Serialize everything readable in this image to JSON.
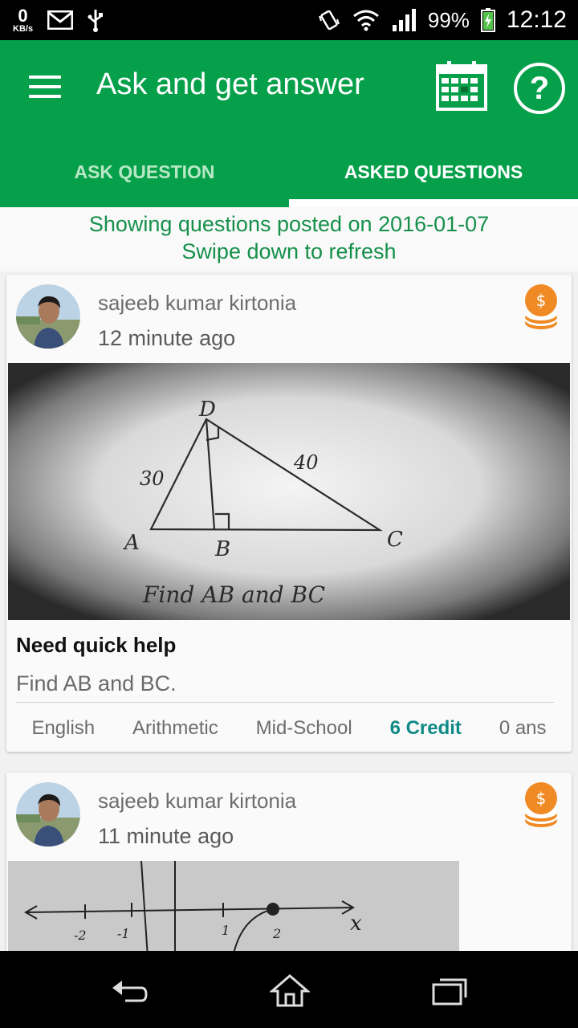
{
  "status_bar": {
    "net_speed_value": "0",
    "net_speed_unit": "KB/s",
    "battery": "99%",
    "time": "12:12"
  },
  "app_bar": {
    "title": "Ask and get answer"
  },
  "tabs": [
    {
      "label": "ASK QUESTION",
      "active": false
    },
    {
      "label": "ASKED QUESTIONS",
      "active": true
    }
  ],
  "info": {
    "posted_line": "Showing questions posted on 2016-01-07",
    "refresh_hint": "Swipe down to refresh"
  },
  "questions": [
    {
      "user": "sajeeb kumar kirtonia",
      "time_ago": "12 minute ago",
      "title": "Need quick help",
      "description": "Find AB and BC.",
      "tags": {
        "language": "English",
        "subject": "Arithmetic",
        "level": "Mid-School",
        "credit": "6 Credit",
        "answers": "0 ans"
      },
      "image_text": {
        "d": "D",
        "a": "A",
        "b": "B",
        "c": "C",
        "s30": "30",
        "s40": "40",
        "caption": "Find AB and BC"
      }
    },
    {
      "user": "sajeeb kumar kirtonia",
      "time_ago": "11 minute ago",
      "image_text": {
        "m2": "-2",
        "m1": "-1",
        "p1": "1",
        "p2": "2",
        "x": "x"
      }
    }
  ],
  "colors": {
    "primary": "#06a04a",
    "info_text": "#15904a",
    "credit": "#0f8a86",
    "coin": "#f08a24"
  },
  "icons": {
    "menu": "hamburger-icon",
    "calendar": "calendar-icon",
    "help": "help-icon",
    "coin": "coin-stack-icon",
    "back": "back-icon",
    "home": "home-icon",
    "recents": "recents-icon"
  },
  "help_glyph": "?",
  "dollar": "$"
}
